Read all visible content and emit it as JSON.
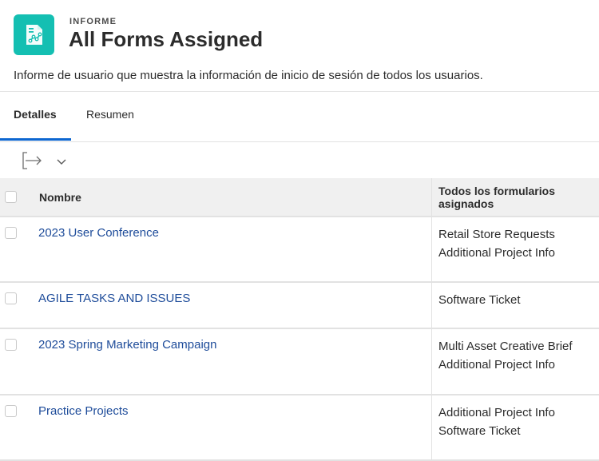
{
  "header": {
    "icon": "report-chart-icon",
    "eyebrow": "INFORME",
    "title": "All Forms Assigned",
    "description": "Informe de usuario que muestra la información de inicio de sesión de todos los usuarios.",
    "accent_color": "#14bfb2"
  },
  "tabs": [
    {
      "label": "Detalles",
      "active": true
    },
    {
      "label": "Resumen",
      "active": false
    }
  ],
  "tab_accent_color": "#0d66d0",
  "toolbar": {
    "export_icon": "export-icon",
    "dropdown_icon": "chevron-down-icon"
  },
  "table": {
    "columns": [
      "Nombre",
      "Todos los formularios asignados"
    ],
    "rows": [
      {
        "name": "2023 User Conference",
        "forms": [
          "Retail Store Requests",
          "Additional Project Info"
        ]
      },
      {
        "name": "AGILE TASKS AND ISSUES",
        "forms": [
          "Software Ticket"
        ]
      },
      {
        "name": "2023 Spring Marketing Campaign",
        "forms": [
          "Multi Asset Creative Brief",
          "Additional Project Info"
        ]
      },
      {
        "name": "Practice Projects",
        "forms": [
          "Additional Project Info",
          "Software Ticket"
        ]
      }
    ],
    "link_color": "#1e4c9a"
  }
}
